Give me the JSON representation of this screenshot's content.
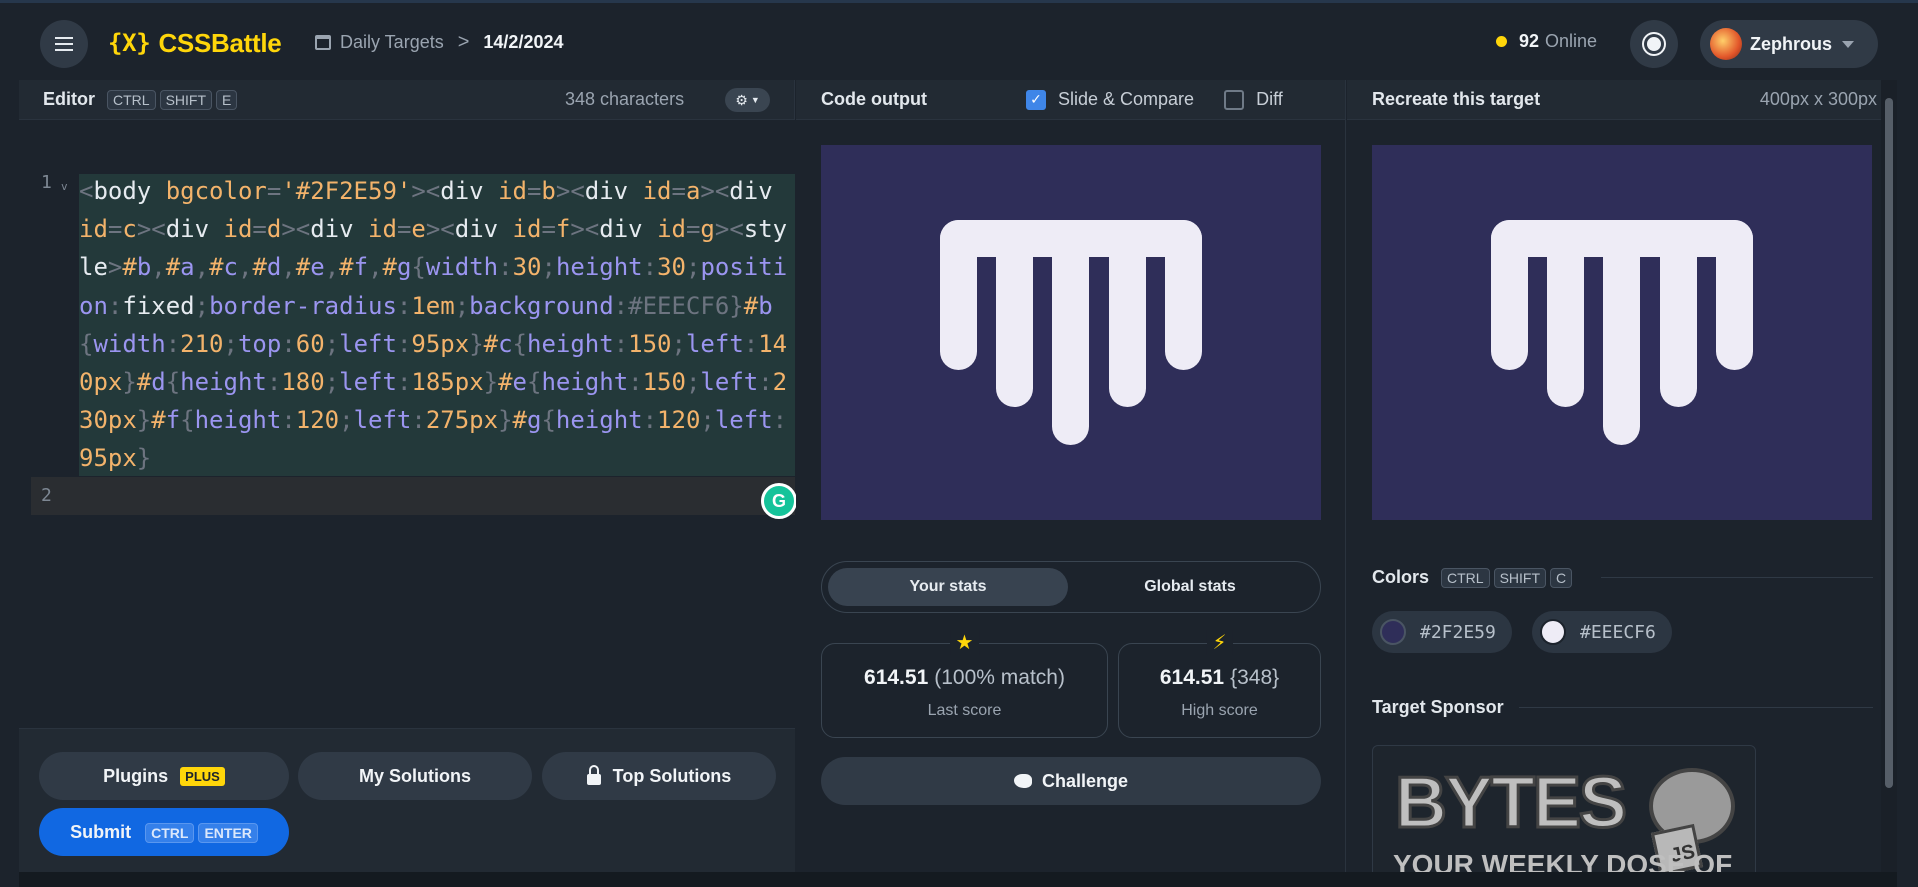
{
  "header": {
    "brand": "CSSBattle",
    "brand_mark": "{X}",
    "breadcrumb_link": "Daily Targets",
    "breadcrumb_sep": ">",
    "breadcrumb_current": "14/2/2024",
    "online_count": "92",
    "online_label": "Online",
    "username": "Zephrous"
  },
  "editor": {
    "title": "Editor",
    "shortcut": [
      "CTRL",
      "SHIFT",
      "E"
    ],
    "char_count": "348 characters",
    "line_numbers": [
      "1",
      "2"
    ],
    "fold_marker": "v"
  },
  "code_tokens": [
    {
      "t": "<",
      "c": "c-punc"
    },
    {
      "t": "body ",
      "c": "c-tag"
    },
    {
      "t": "bgcolor",
      "c": "c-attr"
    },
    {
      "t": "=",
      "c": "c-punc"
    },
    {
      "t": "'#2F2E59'",
      "c": "c-str"
    },
    {
      "t": "><",
      "c": "c-punc"
    },
    {
      "t": "div ",
      "c": "c-tag"
    },
    {
      "t": "id",
      "c": "c-attr"
    },
    {
      "t": "=",
      "c": "c-punc"
    },
    {
      "t": "b",
      "c": "c-str"
    },
    {
      "t": "><",
      "c": "c-punc"
    },
    {
      "t": "div ",
      "c": "c-tag"
    },
    {
      "t": "id",
      "c": "c-attr"
    },
    {
      "t": "=",
      "c": "c-punc"
    },
    {
      "t": "a",
      "c": "c-str"
    },
    {
      "t": "><",
      "c": "c-punc"
    },
    {
      "t": "div ",
      "c": "c-tag"
    },
    {
      "t": "id",
      "c": "c-attr"
    },
    {
      "t": "=",
      "c": "c-punc"
    },
    {
      "t": "c",
      "c": "c-str"
    },
    {
      "t": "><",
      "c": "c-punc"
    },
    {
      "t": "div ",
      "c": "c-tag"
    },
    {
      "t": "id",
      "c": "c-attr"
    },
    {
      "t": "=",
      "c": "c-punc"
    },
    {
      "t": "d",
      "c": "c-str"
    },
    {
      "t": "><",
      "c": "c-punc"
    },
    {
      "t": "div ",
      "c": "c-tag"
    },
    {
      "t": "id",
      "c": "c-attr"
    },
    {
      "t": "=",
      "c": "c-punc"
    },
    {
      "t": "e",
      "c": "c-str"
    },
    {
      "t": "><",
      "c": "c-punc"
    },
    {
      "t": "div ",
      "c": "c-tag"
    },
    {
      "t": "id",
      "c": "c-attr"
    },
    {
      "t": "=",
      "c": "c-punc"
    },
    {
      "t": "f",
      "c": "c-str"
    },
    {
      "t": "><",
      "c": "c-punc"
    },
    {
      "t": "div ",
      "c": "c-tag"
    },
    {
      "t": "id",
      "c": "c-attr"
    },
    {
      "t": "=",
      "c": "c-punc"
    },
    {
      "t": "g",
      "c": "c-str"
    },
    {
      "t": ">",
      "c": "c-punc"
    },
    {
      "t": "<",
      "c": "c-punc"
    },
    {
      "t": "style",
      "c": "c-tag"
    },
    {
      "t": ">",
      "c": "c-punc"
    },
    {
      "t": "#",
      "c": "c-sel"
    },
    {
      "t": "b",
      "c": "c-prop"
    },
    {
      "t": ",",
      "c": "c-punc"
    },
    {
      "t": "#",
      "c": "c-sel"
    },
    {
      "t": "a",
      "c": "c-prop"
    },
    {
      "t": ",",
      "c": "c-punc"
    },
    {
      "t": "#",
      "c": "c-sel"
    },
    {
      "t": "c",
      "c": "c-prop"
    },
    {
      "t": ",",
      "c": "c-punc"
    },
    {
      "t": "#",
      "c": "c-sel"
    },
    {
      "t": "d",
      "c": "c-prop"
    },
    {
      "t": ",",
      "c": "c-punc"
    },
    {
      "t": "#",
      "c": "c-sel"
    },
    {
      "t": "e",
      "c": "c-prop"
    },
    {
      "t": ",",
      "c": "c-punc"
    },
    {
      "t": "#",
      "c": "c-sel"
    },
    {
      "t": "f",
      "c": "c-prop"
    },
    {
      "t": ",",
      "c": "c-punc"
    },
    {
      "t": "#",
      "c": "c-sel"
    },
    {
      "t": "g",
      "c": "c-prop"
    },
    {
      "t": "{",
      "c": "c-punc"
    },
    {
      "t": "width",
      "c": "c-prop"
    },
    {
      "t": ":",
      "c": "c-punc"
    },
    {
      "t": "30",
      "c": "c-num"
    },
    {
      "t": ";",
      "c": "c-punc"
    },
    {
      "t": "height",
      "c": "c-prop"
    },
    {
      "t": ":",
      "c": "c-punc"
    },
    {
      "t": "30",
      "c": "c-num"
    },
    {
      "t": ";",
      "c": "c-punc"
    },
    {
      "t": "position",
      "c": "c-prop"
    },
    {
      "t": ":",
      "c": "c-punc"
    },
    {
      "t": "fixed",
      "c": "c-tag"
    },
    {
      "t": ";",
      "c": "c-punc"
    },
    {
      "t": "border-radius",
      "c": "c-prop"
    },
    {
      "t": ":",
      "c": "c-punc"
    },
    {
      "t": "1em",
      "c": "c-num"
    },
    {
      "t": ";",
      "c": "c-punc"
    },
    {
      "t": "background",
      "c": "c-prop"
    },
    {
      "t": ":",
      "c": "c-punc"
    },
    {
      "t": "#EEECF6",
      "c": "c-punc"
    },
    {
      "t": "}",
      "c": "c-punc"
    },
    {
      "t": "#",
      "c": "c-sel"
    },
    {
      "t": "b",
      "c": "c-prop"
    },
    {
      "t": "{",
      "c": "c-punc"
    },
    {
      "t": "width",
      "c": "c-prop"
    },
    {
      "t": ":",
      "c": "c-punc"
    },
    {
      "t": "210",
      "c": "c-num"
    },
    {
      "t": ";",
      "c": "c-punc"
    },
    {
      "t": "top",
      "c": "c-prop"
    },
    {
      "t": ":",
      "c": "c-punc"
    },
    {
      "t": "60",
      "c": "c-num"
    },
    {
      "t": ";",
      "c": "c-punc"
    },
    {
      "t": "left",
      "c": "c-prop"
    },
    {
      "t": ":",
      "c": "c-punc"
    },
    {
      "t": "95px",
      "c": "c-num"
    },
    {
      "t": "}",
      "c": "c-punc"
    },
    {
      "t": "#",
      "c": "c-sel"
    },
    {
      "t": "c",
      "c": "c-prop"
    },
    {
      "t": "{",
      "c": "c-punc"
    },
    {
      "t": "height",
      "c": "c-prop"
    },
    {
      "t": ":",
      "c": "c-punc"
    },
    {
      "t": "150",
      "c": "c-num"
    },
    {
      "t": ";",
      "c": "c-punc"
    },
    {
      "t": "left",
      "c": "c-prop"
    },
    {
      "t": ":",
      "c": "c-punc"
    },
    {
      "t": "140px",
      "c": "c-num"
    },
    {
      "t": "}",
      "c": "c-punc"
    },
    {
      "t": "#",
      "c": "c-sel"
    },
    {
      "t": "d",
      "c": "c-prop"
    },
    {
      "t": "{",
      "c": "c-punc"
    },
    {
      "t": "height",
      "c": "c-prop"
    },
    {
      "t": ":",
      "c": "c-punc"
    },
    {
      "t": "180",
      "c": "c-num"
    },
    {
      "t": ";",
      "c": "c-punc"
    },
    {
      "t": "left",
      "c": "c-prop"
    },
    {
      "t": ":",
      "c": "c-punc"
    },
    {
      "t": "185px",
      "c": "c-num"
    },
    {
      "t": "}",
      "c": "c-punc"
    },
    {
      "t": "#",
      "c": "c-sel"
    },
    {
      "t": "e",
      "c": "c-prop"
    },
    {
      "t": "{",
      "c": "c-punc"
    },
    {
      "t": "height",
      "c": "c-prop"
    },
    {
      "t": ":",
      "c": "c-punc"
    },
    {
      "t": "150",
      "c": "c-num"
    },
    {
      "t": ";",
      "c": "c-punc"
    },
    {
      "t": "left",
      "c": "c-prop"
    },
    {
      "t": ":",
      "c": "c-punc"
    },
    {
      "t": "230px",
      "c": "c-num"
    },
    {
      "t": "}",
      "c": "c-punc"
    },
    {
      "t": "#",
      "c": "c-sel"
    },
    {
      "t": "f",
      "c": "c-prop"
    },
    {
      "t": "{",
      "c": "c-punc"
    },
    {
      "t": "height",
      "c": "c-prop"
    },
    {
      "t": ":",
      "c": "c-punc"
    },
    {
      "t": "120",
      "c": "c-num"
    },
    {
      "t": ";",
      "c": "c-punc"
    },
    {
      "t": "left",
      "c": "c-prop"
    },
    {
      "t": ":",
      "c": "c-punc"
    },
    {
      "t": "275px",
      "c": "c-num"
    },
    {
      "t": "}",
      "c": "c-punc"
    },
    {
      "t": "#",
      "c": "c-sel"
    },
    {
      "t": "g",
      "c": "c-prop"
    },
    {
      "t": "{",
      "c": "c-punc"
    },
    {
      "t": "height",
      "c": "c-prop"
    },
    {
      "t": ":",
      "c": "c-punc"
    },
    {
      "t": "120",
      "c": "c-num"
    },
    {
      "t": ";",
      "c": "c-punc"
    },
    {
      "t": "left",
      "c": "c-prop"
    },
    {
      "t": ":",
      "c": "c-punc"
    },
    {
      "t": "95px",
      "c": "c-num"
    },
    {
      "t": "}",
      "c": "c-punc"
    }
  ],
  "editor_footer": {
    "plugins_label": "Plugins",
    "plus_badge": "PLUS",
    "my_solutions_label": "My Solutions",
    "top_solutions_label": "Top Solutions",
    "submit_label": "Submit",
    "submit_shortcut": [
      "CTRL",
      "ENTER"
    ]
  },
  "output": {
    "title": "Code output",
    "slide_compare_label": "Slide & Compare",
    "slide_compare_checked": true,
    "diff_label": "Diff",
    "diff_checked": false
  },
  "stats": {
    "tab_yours": "Your stats",
    "tab_global": "Global stats",
    "last_score_value": "614.51",
    "last_score_match": "(100% match)",
    "last_score_label": "Last score",
    "high_score_value": "614.51",
    "high_score_chars": "{348}",
    "high_score_label": "High score",
    "challenge_label": "Challenge"
  },
  "target": {
    "title": "Recreate this target",
    "dimensions": "400px x 300px",
    "colors_title": "Colors",
    "colors_shortcut": [
      "CTRL",
      "SHIFT",
      "C"
    ],
    "colors": [
      {
        "hex": "#2F2E59",
        "swatch": "#2f2e59"
      },
      {
        "hex": "#EEECF6",
        "swatch": "#eeecf6"
      }
    ],
    "sponsor_title": "Target Sponsor",
    "sponsor_word": "BYTES",
    "sponsor_tagline": "YOUR WEEKLY DOSE OF"
  },
  "colors": {
    "accent": "#ffd60a",
    "canvas_bg": "#2f2e59",
    "shape_fill": "#eeecf6",
    "submit_blue": "#1168e2"
  }
}
